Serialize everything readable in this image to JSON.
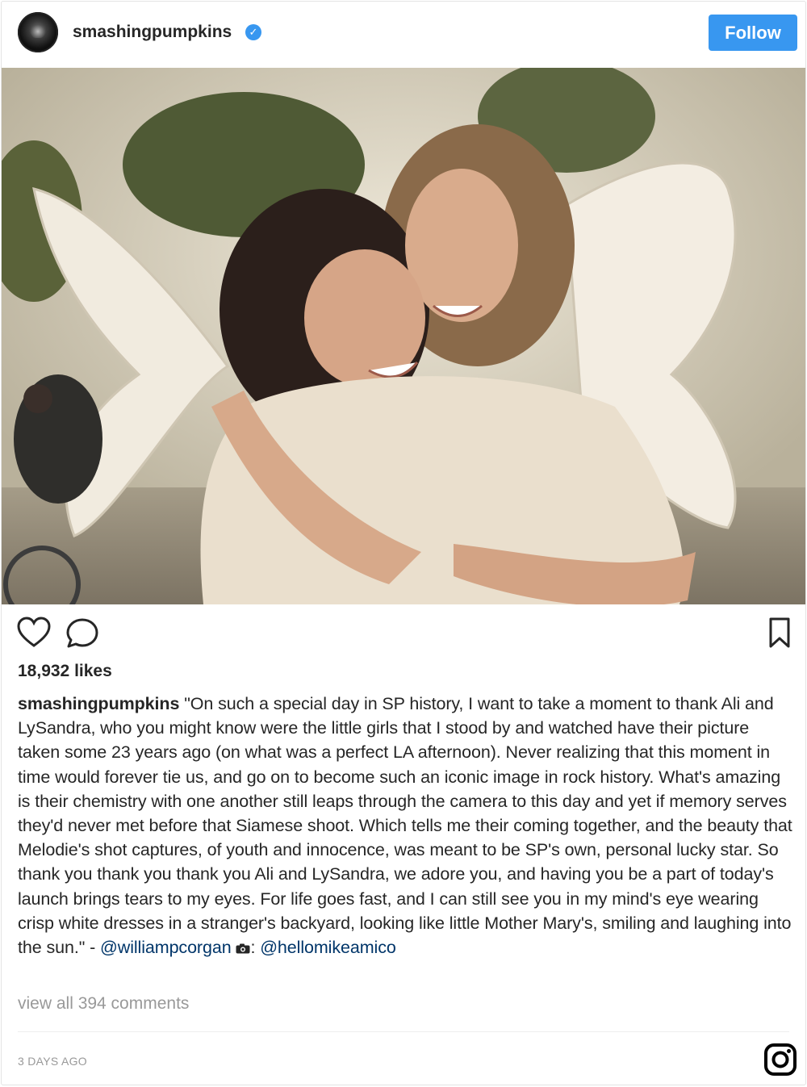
{
  "header": {
    "username": "smashingpumpkins",
    "verified_icon": "verified-badge-icon",
    "follow_label": "Follow",
    "accent": "#3897f0"
  },
  "post": {
    "photo_description_icon": "post-photo",
    "likes": "18,932 likes",
    "caption_user": "smashingpumpkins",
    "caption_text": "\"On such a special day in SP history, I want to take a moment to thank Ali and LySandra, who you might know were the little girls that I stood by and watched have their picture taken some 23 years ago (on what was a perfect LA afternoon). Never realizing that this moment in time would forever tie us, and go on to become such an iconic image in rock history. What's amazing is their chemistry with one another still leaps through the camera to this day and yet if memory serves they'd never met before that Siamese shoot. Which tells me their coming together, and the beauty that Melodie's shot captures, of youth and innocence, was meant to be SP's own, personal lucky star. So thank you thank you thank you Ali and LySandra, we adore you, and having you be a part of today's launch brings tears to my eyes. For life goes fast, and I can still see you in my mind's eye wearing crisp white dresses in a stranger's backyard, looking like little Mother Mary's, smiling and laughing into the sun.\" - ",
    "mention_1": "@williampcorgan",
    "camera_suffix": ": ",
    "mention_2": "@hellomikeamico",
    "view_comments": "view all 394 comments",
    "timestamp": "3 DAYS AGO"
  },
  "icons": {
    "like": "heart-icon",
    "comment": "comment-icon",
    "save": "bookmark-icon",
    "camera": "camera-icon",
    "brand": "instagram-icon"
  }
}
